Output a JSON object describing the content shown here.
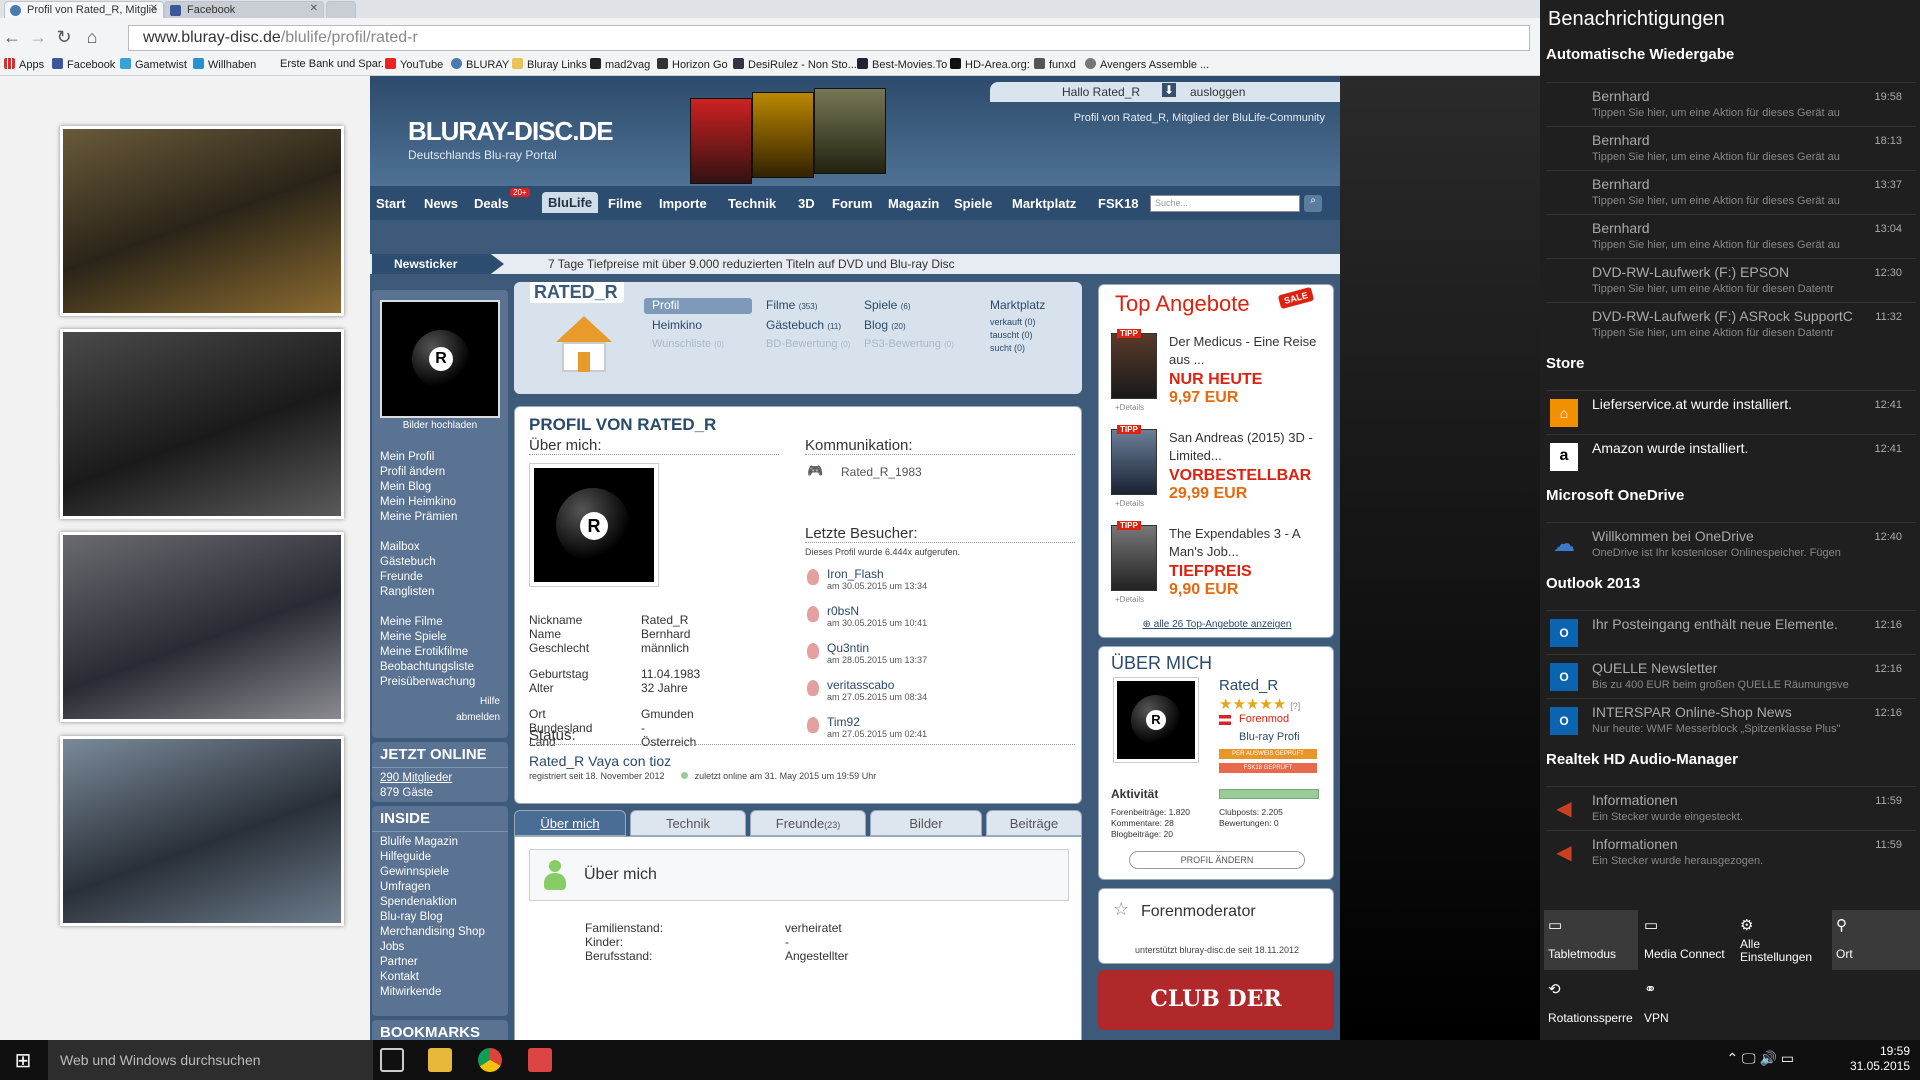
{
  "browser": {
    "tabs": [
      {
        "title": "Profil von Rated_R, Mitglie",
        "active": true
      },
      {
        "title": "Facebook",
        "active": false
      }
    ],
    "url_host": "www.bluray-disc.de",
    "url_path": "/blulife/profil/rated-r",
    "bookmarks": [
      "Apps",
      "Facebook",
      "Gametwist",
      "Willhaben",
      "Erste Bank und Spar...",
      "YouTube",
      "BLURAY",
      "Bluray Links",
      "mad2vag",
      "Horizon Go",
      "DesiRulez - Non Sto...",
      "Best-Movies.To",
      "HD-Area.org:",
      "funxd",
      "Avengers Assemble ..."
    ]
  },
  "site": {
    "logo_main": "BLURAY-DISC.DE",
    "logo_sub": "Deutschlands Blu-ray Portal",
    "user_greeting": "Hallo Rated_R",
    "logout": "ausloggen",
    "profile_line": "Profil von Rated_R, Mitglied der BluLife-Community",
    "nav": [
      "Start",
      "News",
      "Deals",
      "BluLife",
      "Filme",
      "Importe",
      "Technik",
      "3D",
      "Forum",
      "Magazin",
      "Spiele",
      "Marktplatz",
      "FSK18"
    ],
    "deals_badge": "20+",
    "search_placeholder": "Suche...",
    "ticker_label": "Newsticker",
    "ticker_text": "7 Tage Tiefpreise mit über 9.000 reduzierten Titeln auf DVD und Blu-ray Disc",
    "upload_label": "Bilder hochladen",
    "sidebar": {
      "group1": [
        "Mein Profil",
        "Profil ändern",
        "Mein Blog",
        "Mein Heimkino",
        "Meine Prämien"
      ],
      "group2": [
        "Mailbox",
        "Gästebuch",
        "Freunde",
        "Ranglisten"
      ],
      "group3": [
        "Meine Filme",
        "Meine Spiele",
        "Meine Erotikfilme",
        "Beobachtungsliste",
        "Preisüberwachung"
      ],
      "help": "Hilfe",
      "logout": "abmelden",
      "online_title": "JETZT ONLINE",
      "online_members": "290 Mitglieder",
      "online_guests": "879 Gäste",
      "inside_title": "INSIDE",
      "inside": [
        "Blulife Magazin",
        "Hilfeguide",
        "Gewinnspiele",
        "Umfragen",
        "Spendenaktion",
        "Blu-ray Blog",
        "Merchandising Shop",
        "Jobs",
        "Partner",
        "Kontakt",
        "Mitwirkende"
      ],
      "bookmarks_title": "BOOKMARKS"
    },
    "profile_header": {
      "username": "RATED_R",
      "col1": [
        {
          "label": "Profil",
          "count": ""
        },
        {
          "label": "Heimkino",
          "count": ""
        },
        {
          "label": "Wunschliste",
          "count": "(0)"
        }
      ],
      "col2": [
        {
          "label": "Filme",
          "count": "(353)"
        },
        {
          "label": "Gästebuch",
          "count": "(11)"
        },
        {
          "label": "BD-Bewertung",
          "count": "(0)"
        }
      ],
      "col3": [
        {
          "label": "Spiele",
          "count": "(6)"
        },
        {
          "label": "Blog",
          "count": "(20)"
        },
        {
          "label": "PS3-Bewertung",
          "count": "(0)"
        }
      ],
      "market_title": "Marktplatz",
      "market": [
        "verkauft (0)",
        "tauscht (0)",
        "sucht (0)"
      ]
    },
    "profile": {
      "title": "PROFIL VON RATED_R",
      "about_title": "Über mich:",
      "fields": [
        {
          "k": "Nickname",
          "v": "Rated_R"
        },
        {
          "k": "Name",
          "v": "Bernhard"
        },
        {
          "k": "Geschlecht",
          "v": "männlich"
        },
        {
          "k": "Geburtstag",
          "v": "11.04.1983"
        },
        {
          "k": "Alter",
          "v": "32 Jahre"
        },
        {
          "k": "Ort",
          "v": "Gmunden"
        },
        {
          "k": "Bundesland",
          "v": "-"
        },
        {
          "k": "Land",
          "v": "Österreich"
        }
      ],
      "comm_title": "Kommunikation:",
      "comm_value": "Rated_R_1983",
      "visitors_title": "Letzte Besucher:",
      "visits_text": "Dieses Profil wurde 6.444x aufgerufen.",
      "visitors": [
        {
          "name": "Iron_Flash",
          "date": "am 30.05.2015 um 13:34"
        },
        {
          "name": "r0bsN",
          "date": "am 30.05.2015 um 10:41"
        },
        {
          "name": "Qu3ntin",
          "date": "am 28.05.2015 um 13:37"
        },
        {
          "name": "veritasscabo",
          "date": "am 27.05.2015 um 08:34"
        },
        {
          "name": "Tim92",
          "date": "am 27.05.2015 um 02:41"
        }
      ],
      "status_title": "Status:",
      "status_text": "Rated_R Vaya con tioz",
      "registered": "registriert seit 18. November 2012",
      "last_online": "zuletzt online am 31. May 2015 um 19:59 Uhr"
    },
    "profile_tabs": [
      "Über mich",
      "Technik",
      "Freunde",
      "Bilder",
      "Beiträge"
    ],
    "friends_count": "(23)",
    "about_panel": {
      "title": "Über mich",
      "rows": [
        {
          "k": "Familienstand:",
          "v": "verheiratet"
        },
        {
          "k": "Kinder:",
          "v": "-"
        },
        {
          "k": "Berufsstand:",
          "v": "Angestellter"
        }
      ]
    },
    "top_offers": {
      "title": "Top Angebote",
      "sale": "SALE",
      "tipp": "TIPP",
      "details": "+Details",
      "items": [
        {
          "title": "Der Medicus - Eine Reise aus ...",
          "label": "NUR HEUTE",
          "price": "9,97 EUR"
        },
        {
          "title": "San Andreas (2015) 3D - Limited...",
          "label": "VORBESTELLBAR",
          "price": "29,99 EUR"
        },
        {
          "title": "The Expendables 3 - A Man's Job...",
          "label": "TIEFPREIS",
          "price": "9,90 EUR"
        }
      ],
      "all_link": "alle 26 Top-Angebote anzeigen"
    },
    "uber_mich": {
      "title": "ÜBER MICH",
      "name": "Rated_R",
      "rating_note": "[?]",
      "rank": "Forenmod",
      "level": "Blu-ray Profi",
      "badge1": "PER AUSWEIS GEPRÜFT",
      "badge2": "FSK18 GEPRÜFT",
      "activity": "Aktivität",
      "stats_left": [
        {
          "k": "Forenbeiträge:",
          "v": "1.820"
        },
        {
          "k": "Kommentare:",
          "v": "28"
        },
        {
          "k": "Blogbeiträge:",
          "v": "20"
        }
      ],
      "stats_right": [
        {
          "k": "Clubposts:",
          "v": "2.205"
        },
        {
          "k": "Bewertungen:",
          "v": "0"
        }
      ],
      "button": "PROFIL ÄNDERN"
    },
    "moderator": {
      "title": "Forenmoderator",
      "since": "unterstützt bluray-disc.de seit 18.11.2012"
    },
    "club_banner": "CLUB DER"
  },
  "notifications": {
    "title": "Benachrichtigungen",
    "groups": [
      {
        "name": "Automatische Wiedergabe",
        "items": [
          {
            "t1": "Bernhard",
            "t2": "Tippen Sie hier, um eine Aktion für dieses Gerät au",
            "time": "19:58"
          },
          {
            "t1": "Bernhard",
            "t2": "Tippen Sie hier, um eine Aktion für dieses Gerät au",
            "time": "18:13"
          },
          {
            "t1": "Bernhard",
            "t2": "Tippen Sie hier, um eine Aktion für dieses Gerät au",
            "time": "13:37"
          },
          {
            "t1": "Bernhard",
            "t2": "Tippen Sie hier, um eine Aktion für dieses Gerät au",
            "time": "13:04"
          },
          {
            "t1": "DVD-RW-Laufwerk (F:) EPSON",
            "t2": "Tippen Sie hier, um eine Aktion für diesen Datentr",
            "time": "12:30"
          },
          {
            "t1": "DVD-RW-Laufwerk (F:) ASRock SupportC",
            "t2": "Tippen Sie hier, um eine Aktion für diesen Datentr",
            "time": "11:32"
          }
        ]
      },
      {
        "name": "Store",
        "items": [
          {
            "t1": "Lieferservice.at wurde installiert.",
            "t2": "",
            "time": "12:41"
          },
          {
            "t1": "Amazon wurde installiert.",
            "t2": "",
            "time": "12:41"
          }
        ]
      },
      {
        "name": "Microsoft OneDrive",
        "items": [
          {
            "t1": "Willkommen bei OneDrive",
            "t2": "OneDrive ist Ihr kostenloser Onlinespeicher. Fügen",
            "time": "12:40"
          }
        ]
      },
      {
        "name": "Outlook 2013",
        "items": [
          {
            "t1": "Ihr Posteingang enthält neue Elemente.",
            "t2": "",
            "time": "12:16"
          },
          {
            "t1": "QUELLE Newsletter",
            "t2": "Bis zu 400 EUR beim großen QUELLE Räumungsve",
            "time": "12:16"
          },
          {
            "t1": "INTERSPAR Online-Shop News",
            "t2": "Nur heute: WMF Messerblock „Spitzenklasse Plus\"",
            "time": "12:16"
          }
        ]
      },
      {
        "name": "Realtek HD Audio-Manager",
        "items": [
          {
            "t1": "Informationen",
            "t2": "Ein Stecker wurde eingesteckt.",
            "time": "11:59"
          },
          {
            "t1": "Informationen",
            "t2": "Ein Stecker wurde herausgezogen.",
            "time": "11:59"
          }
        ]
      }
    ],
    "quick_actions": [
      "Tabletmodus",
      "Media Connect",
      "Alle Einstellungen",
      "Ort",
      "Rotationssperre",
      "VPN"
    ]
  },
  "taskbar": {
    "search": "Web und Windows durchsuchen",
    "time": "19:59",
    "date": "31.05.2015"
  },
  "colors": {
    "site_blue": "#2d4d70",
    "price_red": "#dd2211",
    "price_orange": "#e8690e",
    "notif_bg": "#1f1f1f"
  }
}
